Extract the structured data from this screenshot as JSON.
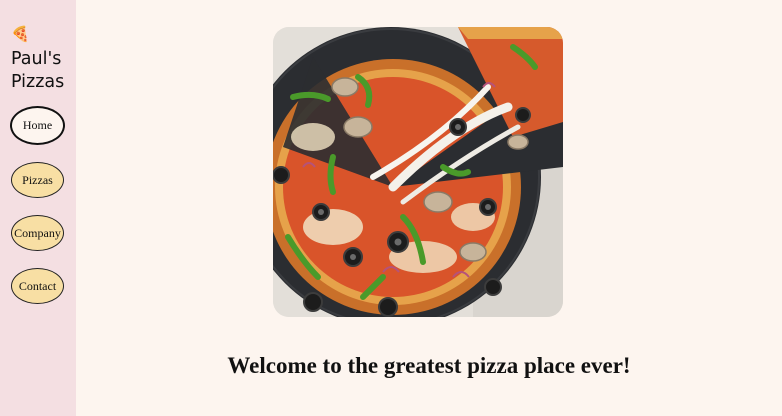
{
  "sidebar": {
    "logo_icon": "🍕",
    "brand": "Paul's\nPizzas",
    "nav": [
      {
        "label": "Home",
        "active": true
      },
      {
        "label": "Pizzas",
        "active": false
      },
      {
        "label": "Company",
        "active": false
      },
      {
        "label": "Contact",
        "active": false
      }
    ]
  },
  "main": {
    "hero_image": "pizza-photo",
    "welcome": "Welcome to the greatest pizza place ever!"
  },
  "colors": {
    "page_bg": "#fdf5ef",
    "sidebar_bg": "#f4dfe2",
    "button_bg": "#f8dfa4"
  }
}
